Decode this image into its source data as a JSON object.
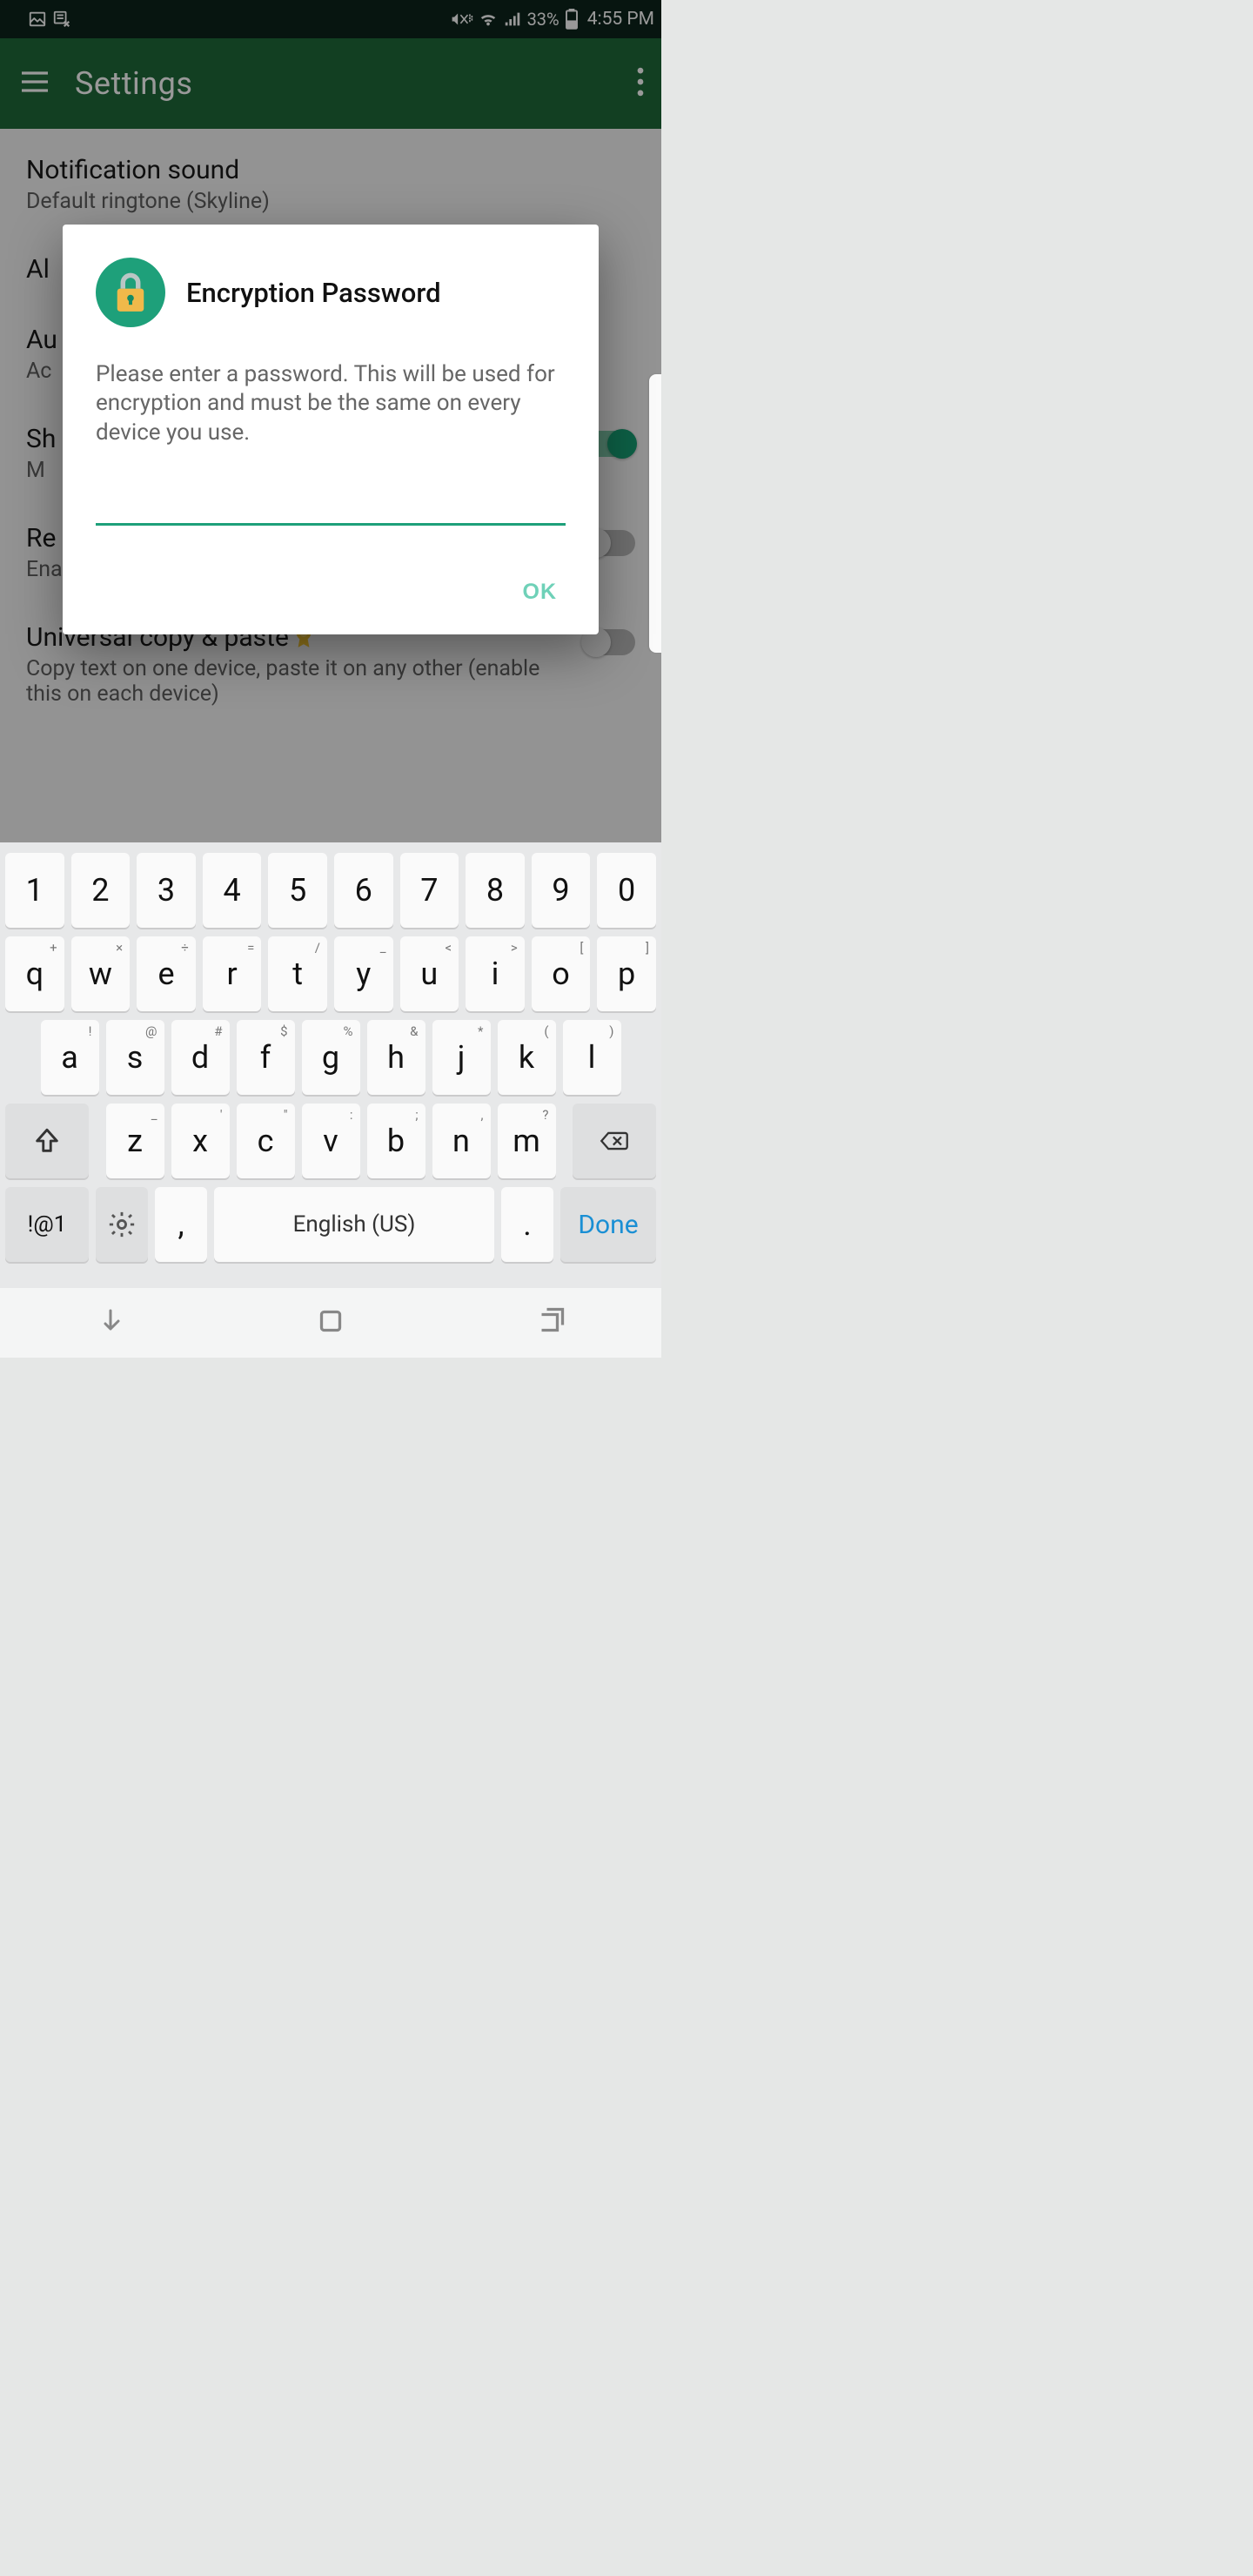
{
  "status": {
    "battery_pct": "33%",
    "time": "4:55 PM"
  },
  "appbar": {
    "title": "Settings"
  },
  "settings": {
    "items": [
      {
        "title": "Notification sound",
        "sub": "Default ringtone (Skyline)"
      },
      {
        "title": "Al",
        "sub": ""
      },
      {
        "title": "Au",
        "sub": "Ac"
      },
      {
        "title": "Sh",
        "sub": "M"
      },
      {
        "title": "Re",
        "sub": "Enable other devices to browse files on this device."
      },
      {
        "title": "Universal copy & paste",
        "sub": "Copy text on one device, paste it on any other (enable this on each device)"
      }
    ]
  },
  "dialog": {
    "title": "Encryption Password",
    "body": "Please enter a password. This will be used for encryption and must be the same on every device you use.",
    "input_value": "",
    "ok": "OK"
  },
  "keyboard": {
    "row1": [
      "1",
      "2",
      "3",
      "4",
      "5",
      "6",
      "7",
      "8",
      "9",
      "0"
    ],
    "row2": [
      {
        "main": "q",
        "alt": "+"
      },
      {
        "main": "w",
        "alt": "×"
      },
      {
        "main": "e",
        "alt": "÷"
      },
      {
        "main": "r",
        "alt": "="
      },
      {
        "main": "t",
        "alt": "/"
      },
      {
        "main": "y",
        "alt": "_"
      },
      {
        "main": "u",
        "alt": "<"
      },
      {
        "main": "i",
        "alt": ">"
      },
      {
        "main": "o",
        "alt": "["
      },
      {
        "main": "p",
        "alt": "]"
      }
    ],
    "row3": [
      {
        "main": "a",
        "alt": "!"
      },
      {
        "main": "s",
        "alt": "@"
      },
      {
        "main": "d",
        "alt": "#"
      },
      {
        "main": "f",
        "alt": "$"
      },
      {
        "main": "g",
        "alt": "%"
      },
      {
        "main": "h",
        "alt": "&"
      },
      {
        "main": "j",
        "alt": "*"
      },
      {
        "main": "k",
        "alt": "("
      },
      {
        "main": "l",
        "alt": ")"
      }
    ],
    "row4": [
      {
        "main": "z",
        "alt": "_"
      },
      {
        "main": "x",
        "alt": "'"
      },
      {
        "main": "c",
        "alt": "\""
      },
      {
        "main": "v",
        "alt": ":"
      },
      {
        "main": "b",
        "alt": ";"
      },
      {
        "main": "n",
        "alt": ","
      },
      {
        "main": "m",
        "alt": "?"
      }
    ],
    "sym": "!@1",
    "space": "English (US)",
    "done": "Done",
    "comma": ",",
    "dot": "."
  }
}
